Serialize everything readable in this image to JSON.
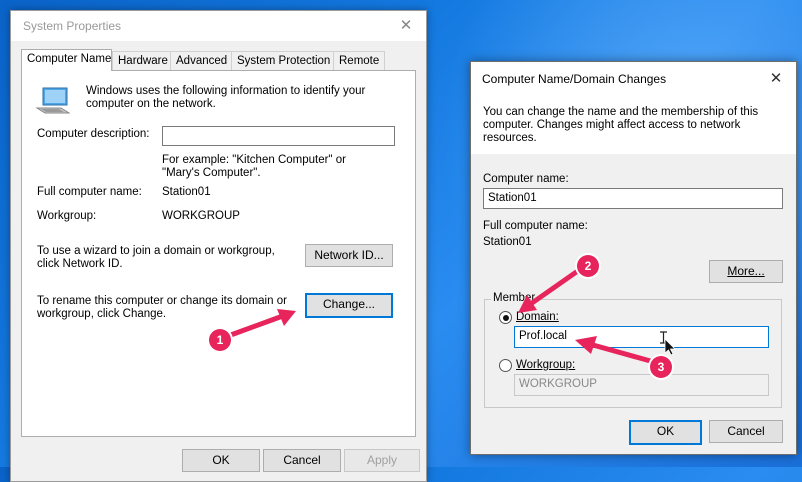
{
  "system_properties": {
    "title": "System Properties",
    "tabs": [
      "Computer Name",
      "Hardware",
      "Advanced",
      "System Protection",
      "Remote"
    ],
    "intro": "Windows uses the following information to identify your computer on the network.",
    "description_label": "Computer description:",
    "description_value": "",
    "example": "For example: \"Kitchen Computer\" or \"Mary's Computer\".",
    "full_name_label": "Full computer name:",
    "full_name_value": "Station01",
    "workgroup_label": "Workgroup:",
    "workgroup_value": "WORKGROUP",
    "wizard_text": "To use a wizard to join a domain or workgroup, click Network ID.",
    "network_id_button": "Network ID...",
    "rename_text": "To rename this computer or change its domain or workgroup, click Change.",
    "change_button": "Change...",
    "ok_button": "OK",
    "cancel_button": "Cancel",
    "apply_button": "Apply"
  },
  "domain_dialog": {
    "title": "Computer Name/Domain Changes",
    "intro": "You can change the name and the membership of this computer. Changes might affect access to network resources.",
    "computer_name_label": "Computer name:",
    "computer_name_value": "Station01",
    "full_name_label": "Full computer name:",
    "full_name_value": "Station01",
    "more_button": "More...",
    "member_of_label": "Member",
    "domain_label": "Domain:",
    "domain_value": "Prof.local",
    "workgroup_label": "Workgroup:",
    "workgroup_value": "WORKGROUP",
    "ok_button": "OK",
    "cancel_button": "Cancel",
    "domain_selected": true
  },
  "annotations": [
    {
      "number": "1"
    },
    {
      "number": "2"
    },
    {
      "number": "3"
    }
  ],
  "colors": {
    "accent": "#0078d7",
    "annotation": "#e8245c",
    "desktop": "#1479e0"
  }
}
